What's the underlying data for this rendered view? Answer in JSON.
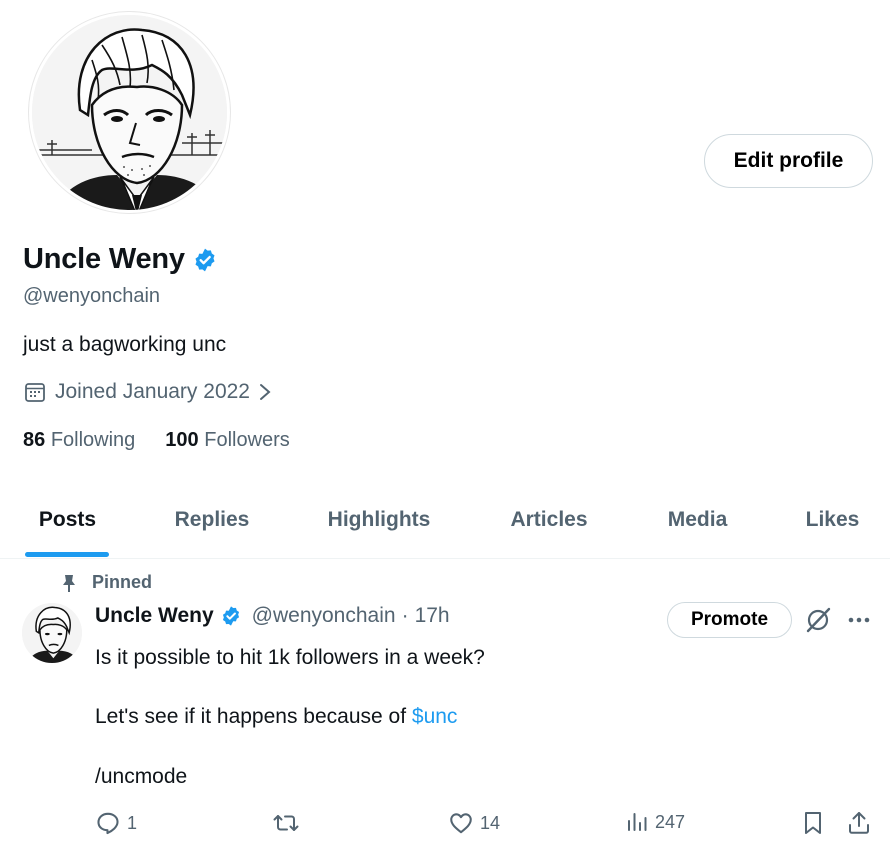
{
  "profile": {
    "name": "Uncle Weny",
    "handle": "@wenyonchain",
    "bio": "just a bagworking unc",
    "joined": "Joined January 2022",
    "following_count": "86",
    "following_label": "Following",
    "followers_count": "100",
    "followers_label": "Followers",
    "edit_button": "Edit profile"
  },
  "tabs": [
    {
      "label": "Posts",
      "active": true
    },
    {
      "label": "Replies"
    },
    {
      "label": "Highlights"
    },
    {
      "label": "Articles"
    },
    {
      "label": "Media"
    },
    {
      "label": "Likes"
    }
  ],
  "post": {
    "pinned_label": "Pinned",
    "author": "Uncle Weny",
    "handle": "@wenyonchain",
    "sep": "·",
    "time": "17h",
    "promote_label": "Promote",
    "line1": "Is it possible to hit 1k followers in a week?",
    "line2_prefix": "Let's see if it happens because of ",
    "cashtag": "$unc",
    "line3": "/uncmode",
    "replies": "1",
    "likes": "14",
    "views": "247"
  },
  "colors": {
    "accent": "#1d9bf0",
    "text": "#0f1419",
    "muted": "#536471",
    "border": "#cfd9de"
  }
}
